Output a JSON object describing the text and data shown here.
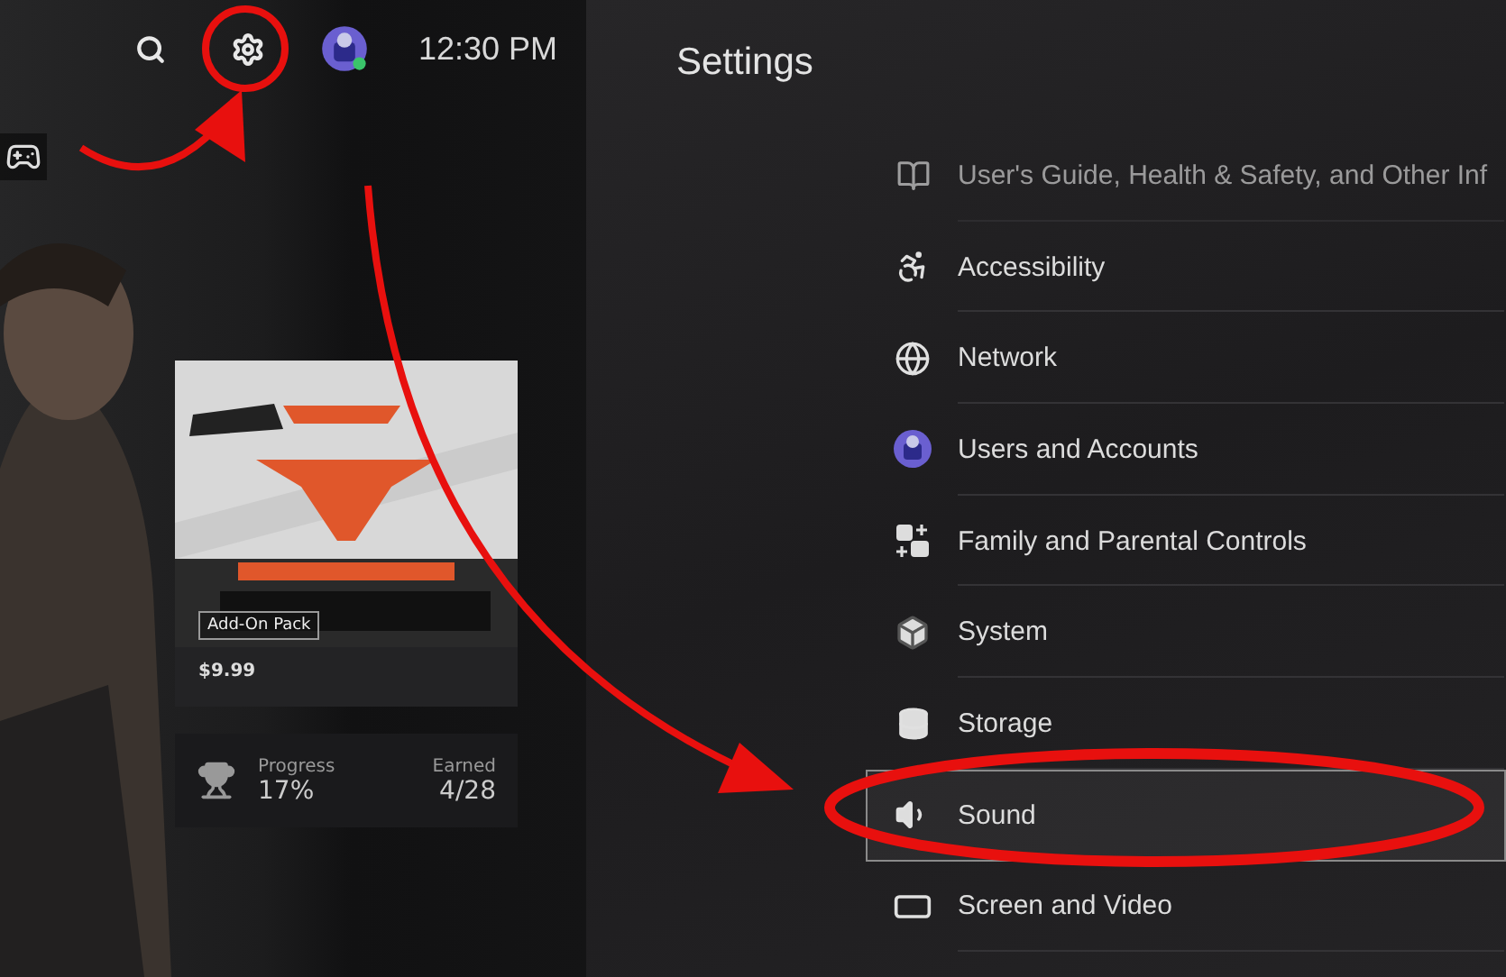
{
  "top_bar": {
    "time": "12:30 PM"
  },
  "game_hub": {
    "product": {
      "tag": "Add-On Pack",
      "price": "$9.99"
    },
    "trophies": {
      "progress_label": "Progress",
      "progress_value": "17%",
      "earned_label": "Earned",
      "earned_value": "4/28"
    }
  },
  "settings": {
    "title": "Settings",
    "items": [
      {
        "label": "User's Guide, Health & Safety, and Other Inf",
        "selected": false
      },
      {
        "label": "Accessibility",
        "selected": false
      },
      {
        "label": "Network",
        "selected": false
      },
      {
        "label": "Users and Accounts",
        "selected": false
      },
      {
        "label": "Family and Parental Controls",
        "selected": false
      },
      {
        "label": "System",
        "selected": false
      },
      {
        "label": "Storage",
        "selected": false
      },
      {
        "label": "Sound",
        "selected": true
      },
      {
        "label": "Screen and Video",
        "selected": false
      }
    ]
  }
}
